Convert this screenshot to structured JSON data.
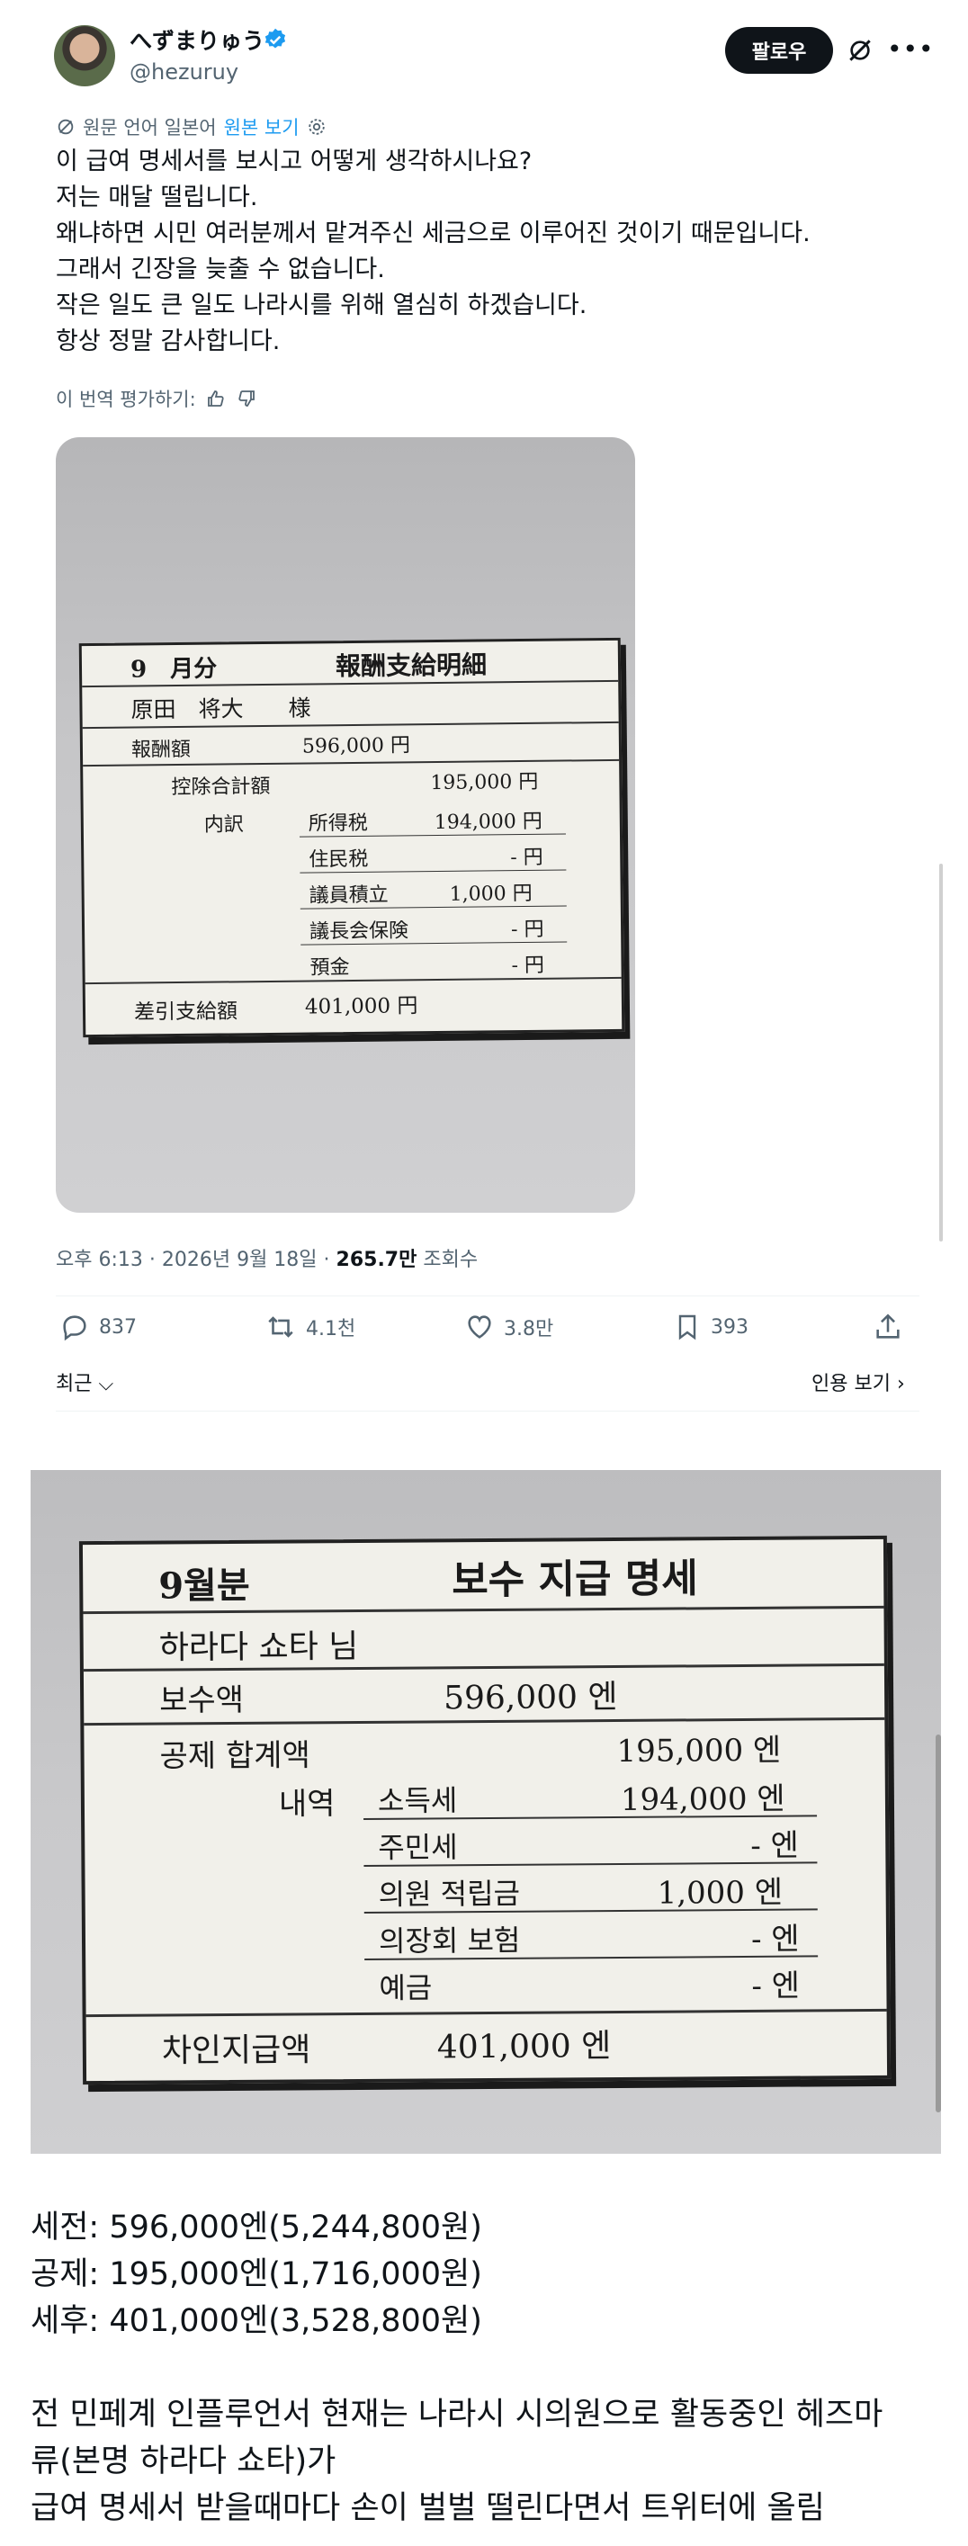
{
  "header": {
    "display_name": "へずまりゅう",
    "handle": "@hezuruy",
    "follow_label": "팔로우"
  },
  "translation": {
    "notice": "원문 언어 일본어",
    "show_original": "원본 보기"
  },
  "tweet": {
    "lines": [
      "이 급여 명세서를 보시고 어떻게 생각하시나요?",
      "저는 매달 떨립니다.",
      "왜냐하면 시민 여러분께서 맡겨주신 세금으로 이루어진 것이기 때문입니다.",
      "그래서 긴장을 늦출 수 없습니다.",
      "작은 일도 큰 일도 나라시를 위해 열심히 하겠습니다.",
      "항상 정말 감사합니다."
    ],
    "rate_label": "이 번역 평가하기:"
  },
  "slip_jp": {
    "month": "9　月分",
    "title": "報酬支給明細",
    "recipient": "原田　将大　　様",
    "pay_label": "報酬額",
    "pay_value": "596,000 円",
    "deduct_label": "控除合計額",
    "deduct_value": "195,000 円",
    "breakdown_label": "内訳",
    "items": [
      {
        "label": "所得税",
        "value": "194,000 円"
      },
      {
        "label": "住民税",
        "value": "- 円"
      },
      {
        "label": "議員積立",
        "value": "1,000 円"
      },
      {
        "label": "議長会保険",
        "value": "- 円"
      },
      {
        "label": "預金",
        "value": "- 円"
      }
    ],
    "net_label": "差引支給額",
    "net_value": "401,000 円"
  },
  "meta": {
    "time": "오후 6:13 · 2026년 9월 18일 · ",
    "views": "265.7만",
    "views_label": " 조회수"
  },
  "actions": {
    "replies": "837",
    "retweets": "4.1천",
    "likes": "3.8만",
    "bookmarks": "393"
  },
  "sort_label": "최근",
  "quote_label": "인용 보기",
  "slip_kr": {
    "month": "9월분",
    "title": "보수 지급 명세",
    "recipient": "하라다 쇼타 님",
    "pay_label": "보수액",
    "pay_value": "596,000 엔",
    "deduct_label": "공제 합계액",
    "deduct_value": "195,000 엔",
    "breakdown_label": "내역",
    "items": [
      {
        "label": "소득세",
        "value": "194,000 엔"
      },
      {
        "label": "주민세",
        "value": "- 엔"
      },
      {
        "label": "의원 적립금",
        "value": "1,000 엔"
      },
      {
        "label": "의장회 보험",
        "value": "- 엔"
      },
      {
        "label": "예금",
        "value": "- 엔"
      }
    ],
    "net_label": "차인지급액",
    "net_value": "401,000 엔"
  },
  "caption": {
    "lines": [
      "세전: 596,000엔(5,244,800원)",
      "공제: 195,000엔(1,716,000원)",
      "세후: 401,000엔(3,528,800원)",
      "",
      "전 민페계 인플루언서 현재는 나라시 시의원으로 활동중인 헤즈마",
      "류(본명 하라다 쇼타)가",
      "급여 명세서 받을때마다 손이 벌벌 떨린다면서 트위터에 올림"
    ]
  },
  "colors": {
    "link": "#1d9bf0",
    "muted": "#536471",
    "text": "#0f1419"
  }
}
